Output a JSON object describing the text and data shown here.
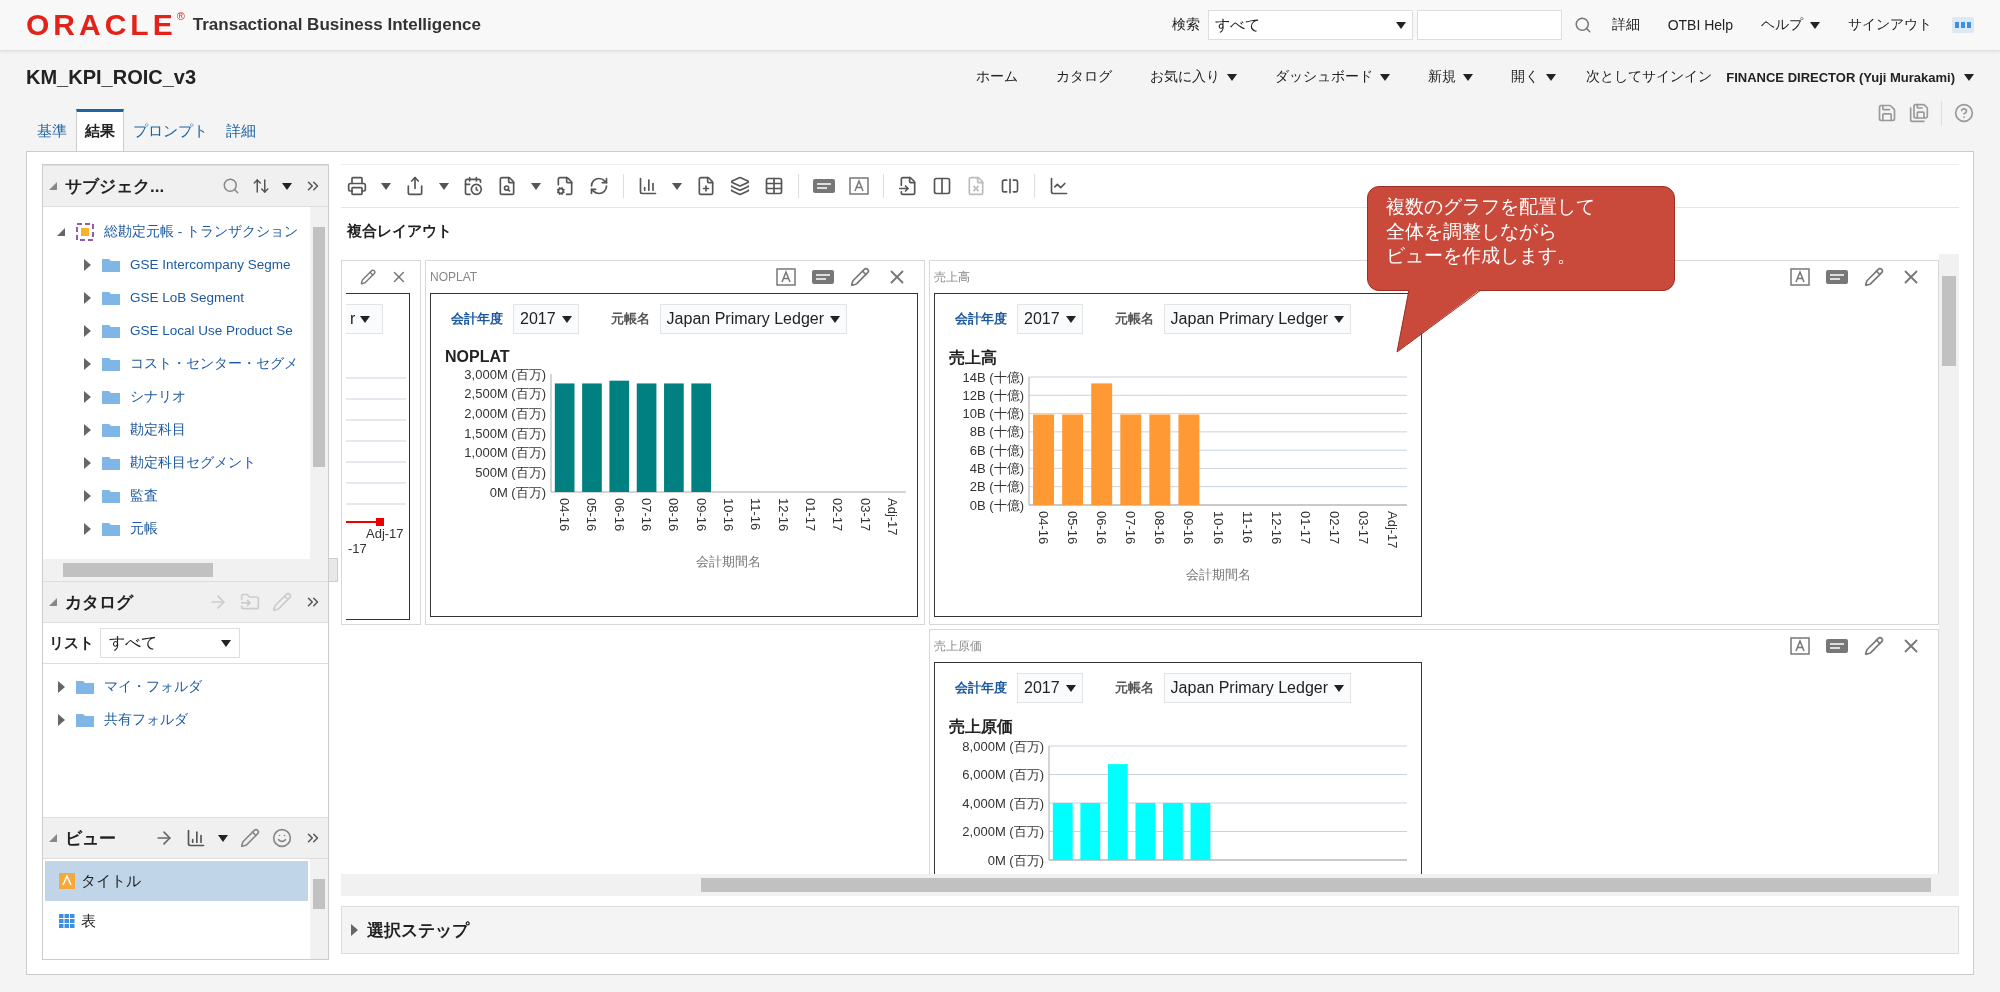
{
  "header": {
    "logo": "ORACLE",
    "logo_mark": "®",
    "product": "Transactional Business Intelligence",
    "search_label": "検索",
    "search_scope": "すべて",
    "links": [
      {
        "label": "詳細",
        "has_menu": false
      },
      {
        "label": "OTBI Help",
        "has_menu": false
      },
      {
        "label": "ヘルプ",
        "has_menu": true
      },
      {
        "label": "サインアウト",
        "has_menu": false
      }
    ]
  },
  "title": "KM_KPI_ROIC_v3",
  "nav": [
    {
      "label": "ホーム",
      "has_menu": false
    },
    {
      "label": "カタログ",
      "has_menu": false
    },
    {
      "label": "お気に入り",
      "has_menu": true
    },
    {
      "label": "ダッシュボード",
      "has_menu": true
    },
    {
      "label": "新規",
      "has_menu": true
    },
    {
      "label": "開く",
      "has_menu": true
    }
  ],
  "signed_in_label": "次としてサインイン",
  "user": "FINANCE DIRECTOR (Yuji Murakami)",
  "tabs": [
    {
      "label": "基準",
      "selected": false
    },
    {
      "label": "結果",
      "selected": true
    },
    {
      "label": "プロンプト",
      "selected": false
    },
    {
      "label": "詳細",
      "selected": false
    }
  ],
  "subject_area": {
    "title": "サブジェク...",
    "tree": [
      {
        "label": "総勘定元帳 - トランザクション",
        "kind": "subject_area",
        "expanded": true,
        "children": [
          {
            "label": "GSE Intercompany Segme",
            "kind": "folder",
            "expanded": false
          },
          {
            "label": "GSE LoB Segment",
            "kind": "folder",
            "expanded": false
          },
          {
            "label": "GSE Local Use Product Se",
            "kind": "folder",
            "expanded": false
          },
          {
            "label": "コスト・センター・セグメ",
            "kind": "folder",
            "expanded": false
          },
          {
            "label": "シナリオ",
            "kind": "folder",
            "expanded": false
          },
          {
            "label": "勘定科目",
            "kind": "folder",
            "expanded": false
          },
          {
            "label": "勘定科目セグメント",
            "kind": "folder",
            "expanded": false
          },
          {
            "label": "監査",
            "kind": "folder",
            "expanded": false
          },
          {
            "label": "元帳",
            "kind": "folder",
            "expanded": false
          }
        ]
      }
    ]
  },
  "catalog": {
    "title": "カタログ",
    "list_label": "リスト",
    "list_value": "すべて",
    "items": [
      {
        "label": "マイ・フォルダ",
        "kind": "folder",
        "expanded": false
      },
      {
        "label": "共有フォルダ",
        "kind": "folder",
        "expanded": false
      }
    ]
  },
  "views_panel": {
    "title": "ビュー",
    "items": [
      {
        "label": "タイトル",
        "kind": "title",
        "selected": true
      },
      {
        "label": "表",
        "kind": "table",
        "selected": false
      }
    ]
  },
  "layout_title": "複合レイアウト",
  "partial_view": {
    "dropdown_fragment": "r",
    "axis_labels": [
      "Adj-17",
      "-17"
    ]
  },
  "views": [
    {
      "caption": "NOPLAT",
      "year_label": "会計年度",
      "year": "2017",
      "ledger_label": "元帳名",
      "ledger": "Japan Primary Ledger",
      "chart_data": {
        "type": "bar",
        "grid": false,
        "title": "NOPLAT",
        "xlabel": "会計期間名",
        "categories": [
          "04-16",
          "05-16",
          "06-16",
          "07-16",
          "08-16",
          "09-16",
          "10-16",
          "11-16",
          "12-16",
          "01-17",
          "02-17",
          "03-17",
          "Adj-17"
        ],
        "series": [
          {
            "color": "#008080",
            "values": [
              2760,
              2760,
              2830,
              2760,
              2760,
              2760,
              null,
              null,
              null,
              null,
              null,
              null,
              null
            ]
          }
        ],
        "ylim": [
          0,
          3000
        ],
        "yticks": [
          {
            "value": 0,
            "label": "0M (百万)"
          },
          {
            "value": 500,
            "label": "500M (百万)"
          },
          {
            "value": 1000,
            "label": "1,000M (百万)"
          },
          {
            "value": 1500,
            "label": "1,500M (百万)"
          },
          {
            "value": 2000,
            "label": "2,000M (百万)"
          },
          {
            "value": 2500,
            "label": "2,500M (百万)"
          },
          {
            "value": 3000,
            "label": "3,000M (百万)"
          }
        ]
      }
    },
    {
      "caption": "売上高",
      "year_label": "会計年度",
      "year": "2017",
      "ledger_label": "元帳名",
      "ledger": "Japan Primary Ledger",
      "chart_data": {
        "type": "bar",
        "grid": true,
        "title": "売上高",
        "xlabel": "会計期間名",
        "categories": [
          "04-16",
          "05-16",
          "06-16",
          "07-16",
          "08-16",
          "09-16",
          "10-16",
          "11-16",
          "12-16",
          "01-17",
          "02-17",
          "03-17",
          "Adj-17"
        ],
        "series": [
          {
            "color": "#ff9933",
            "values": [
              9.9,
              9.9,
              13.3,
              9.9,
              9.9,
              9.9,
              null,
              null,
              null,
              null,
              null,
              null,
              null
            ]
          }
        ],
        "ylim": [
          0,
          14
        ],
        "yticks": [
          {
            "value": 0,
            "label": "0B (十億)"
          },
          {
            "value": 2,
            "label": "2B (十億)"
          },
          {
            "value": 4,
            "label": "4B (十億)"
          },
          {
            "value": 6,
            "label": "6B (十億)"
          },
          {
            "value": 8,
            "label": "8B (十億)"
          },
          {
            "value": 10,
            "label": "10B (十億)"
          },
          {
            "value": 12,
            "label": "12B (十億)"
          },
          {
            "value": 14,
            "label": "14B (十億)"
          }
        ]
      }
    },
    {
      "caption": "売上原価",
      "year_label": "会計年度",
      "year": "2017",
      "ledger_label": "元帳名",
      "ledger": "Japan Primary Ledger",
      "chart_data": {
        "type": "bar",
        "grid": true,
        "title": "売上原価",
        "series": [
          {
            "color": "#00ffff",
            "values": [
              4000,
              4000,
              6730,
              4000,
              4000,
              4000
            ]
          }
        ],
        "ylim": [
          0,
          8000
        ],
        "yticks": [
          {
            "value": 0,
            "label": "0M (百万)"
          },
          {
            "value": 2000,
            "label": "2,000M (百万)"
          },
          {
            "value": 4000,
            "label": "4,000M (百万)"
          },
          {
            "value": 6000,
            "label": "6,000M (百万)"
          },
          {
            "value": 8000,
            "label": "8,000M (百万)"
          }
        ]
      }
    }
  ],
  "selection_steps": {
    "label": "選択ステップ",
    "expanded": false
  },
  "callout": {
    "lines": [
      "複数のグラフを配置して",
      "全体を調整しながら",
      "ビューを作成します。"
    ]
  }
}
